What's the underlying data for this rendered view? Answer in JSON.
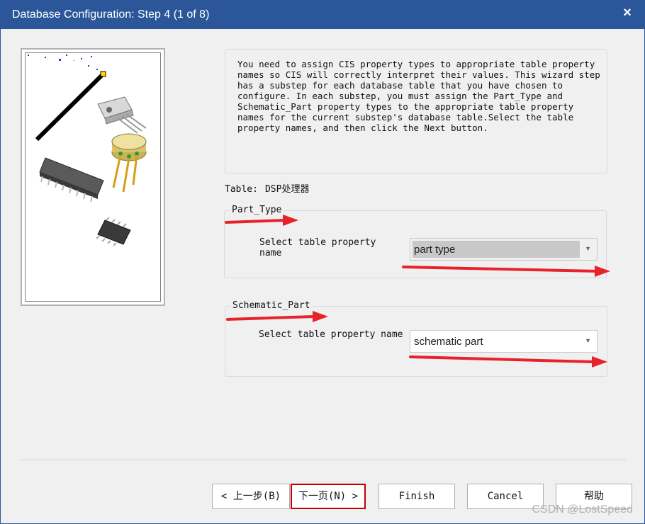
{
  "window": {
    "title": "Database Configuration: Step 4 (1 of 8)",
    "close_glyph": "×"
  },
  "description": "You need to assign CIS property types to appropriate table property names so CIS will correctly interpret their values. This wizard step has a substep for each database table that you have chosen to configure. In each substep, you must assign the Part_Type and Schematic_Part property types to the appropriate table property names for the current substep's database table.Select the table property names, and then click the Next button.",
  "table": {
    "label": "Table:",
    "value": "DSP处理器"
  },
  "part_type": {
    "legend": "Part_Type",
    "select_label": "Select table property name",
    "selected_value": "part type"
  },
  "schematic_part": {
    "legend": "Schematic_Part",
    "select_label": "Select table property name",
    "selected_value": "schematic part"
  },
  "buttons": {
    "back": "< 上一步(B)",
    "next": "下一页(N) >",
    "finish": "Finish",
    "cancel": "Cancel",
    "help": "帮助"
  },
  "watermark": "CSDN @LostSpeed",
  "colors": {
    "titlebar": "#2b579a",
    "annotation_red": "#e8222a",
    "focus_border": "#c00000"
  }
}
